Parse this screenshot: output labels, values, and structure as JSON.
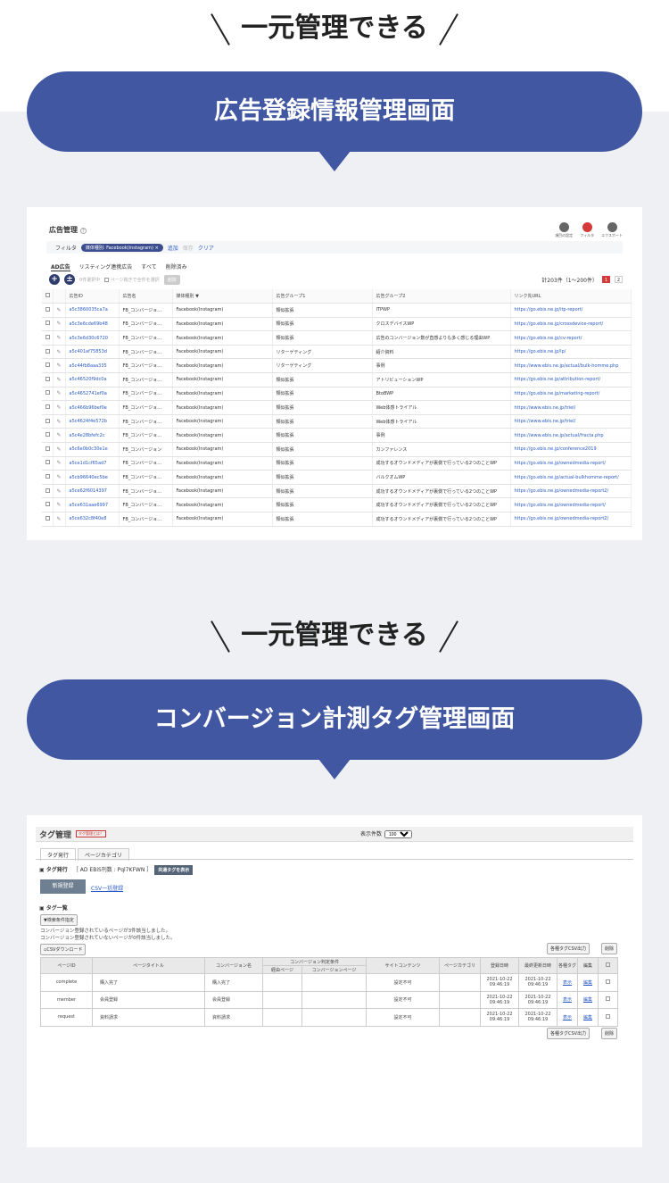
{
  "tagline": "一元管理できる",
  "section1": "広告登録情報管理画面",
  "section2": "コンバージョン計測タグ管理画面",
  "ad": {
    "title": "広告管理",
    "help": "?",
    "icons": [
      {
        "label": "項目の設定",
        "name": "settings-icon"
      },
      {
        "label": "フィルタ",
        "name": "filter-icon"
      },
      {
        "label": "エクスポート",
        "name": "export-icon"
      }
    ],
    "filter_label": "フィルタ",
    "filter_chip": "媒体種別: Facebook(Instagram) ×",
    "filter_add": "追加",
    "filter_save": "保存",
    "filter_clear": "クリア",
    "tabs": [
      "AD広告",
      "リスティング連携広告",
      "すべて",
      "削除済み"
    ],
    "add": "+",
    "upload": "±",
    "selected": "0件選択中",
    "select_all": "ページ跨ぎで全件を選択",
    "delete": "削除",
    "count": "計203件（1〜200件）",
    "pages": [
      "1",
      "2"
    ],
    "cols": [
      "",
      "",
      "広告ID",
      "広告名",
      "媒体種別 ▼",
      "広告グループ1",
      "広告グループ2",
      "リンク先URL"
    ],
    "rows": [
      [
        "a5c3860035ca7a",
        "FB_コンバージョ…",
        "Facebook(Instagram)",
        "類似拡張",
        "ITPWP",
        "https://go.ebis.ne.jp/itp-report/"
      ],
      [
        "a5c3e6cde69b48",
        "FB_コンバージョ…",
        "Facebook(Instagram)",
        "類似拡張",
        "クロスデバイスWP",
        "https://go.ebis.ne.jp/crossdevice-report/"
      ],
      [
        "a5c3e6d30c6720",
        "FB_コンバージョ…",
        "Facebook(Instagram)",
        "類似拡張",
        "広告のコンバージョン数が直感よりも多く感じる理由WP",
        "https://go.ebis.ne.jp/cv-report/"
      ],
      [
        "a5c401af75853d",
        "FB_コンバージョ…",
        "Facebook(Instagram)",
        "リターゲティング",
        "紹介資料",
        "https://go.ebis.ne.jp/lp/"
      ],
      [
        "a5c44fb8aaa335",
        "FB_コンバージョ…",
        "Facebook(Instagram)",
        "リターゲティング",
        "事例",
        "https://www.ebis.ne.jp/actual/bulk-homme.php"
      ],
      [
        "a5c46520f9dc0a",
        "FB_コンバージョ…",
        "Facebook(Instagram)",
        "類似拡張",
        "アトリビューションWP",
        "https://go.ebis.ne.jp/attribution-report/"
      ],
      [
        "a5c4652741ef0a",
        "FB_コンバージョ…",
        "Facebook(Instagram)",
        "類似拡張",
        "BtoBWP",
        "https://go.ebis.ne.jp/marketing-report/"
      ],
      [
        "a5c466b96bef0e",
        "FB_コンバージョ…",
        "Facebook(Instagram)",
        "類似拡張",
        "Web体感トライアル",
        "https://www.ebis.ne.jp/triel/"
      ],
      [
        "a5c4624f4e572b",
        "FB_コンバージョ…",
        "Facebook(Instagram)",
        "類似拡張",
        "Web体感トライアル",
        "https://www.ebis.ne.jp/triel/"
      ],
      [
        "a5c4e28bfefc2c",
        "FB_コンバージョ…",
        "Facebook(Instagram)",
        "類似拡張",
        "事例",
        "https://www.ebis.ne.jp/actual/fracta.php"
      ],
      [
        "a5c6e0b0c30e1e",
        "FB_コンバージョン",
        "Facebook(Instagram)",
        "類似拡張",
        "カンファレンス",
        "https://go.ebis.ne.jp/conference2019"
      ],
      [
        "a5ce1d1cf65ad7",
        "FB_コンバージョ…",
        "Facebook(Instagram)",
        "類似拡張",
        "成功するオウンドメディアが裏側で行っている2つのことWP",
        "https://go.ebis.ne.jp/ownedmedia-report/"
      ],
      [
        "a5cb96640ec5be",
        "FB_コンバージョ…",
        "Facebook(Instagram)",
        "類似拡張",
        "バルクオムWP",
        "https://go.ebis.ne.jp/actual-bulkhomme-report/"
      ],
      [
        "a5ce62f6014397",
        "FB_コンバージョ…",
        "Facebook(Instagram)",
        "類似拡張",
        "成功するオウンドメディアが裏側で行っている2つのことWP",
        "https://go.ebis.ne.jp/ownedmedia-report2/"
      ],
      [
        "a5ce631aae6997",
        "FB_コンバージョ…",
        "Facebook(Instagram)",
        "類似拡張",
        "成功するオウンドメディアが裏側で行っている2つのことWP",
        "https://go.ebis.ne.jp/ownedmedia-report/"
      ],
      [
        "a5ce632c8f40e8",
        "FB_コンバージョ…",
        "Facebook(Instagram)",
        "類似拡張",
        "成功するオウンドメディアが裏側で行っている2つのことWP",
        "https://go.ebis.ne.jp/ownedmedia-report2/"
      ]
    ]
  },
  "tag": {
    "title": "タグ管理",
    "badge": "タグ管理とは？",
    "display_count": "表示件数",
    "display_value": "100",
    "tabs": [
      "タグ発行",
      "ページカテゴリ"
    ],
    "issue_title": "タグ発行",
    "ebis_id": "［ AD EBiS刊数 : Pql7KFWN ］",
    "common_tag": "共通タグを表示",
    "new_btn": "新規登録",
    "csv_bulk": "CSV一括登録",
    "list_title": "タグ一覧",
    "search_btn": "検索条件指定",
    "info1": "コンバージョン登録されているページが3件該当しました。",
    "info2": "コンバージョン登録されていないページが0件該当しました。",
    "csv_dl": "CSVダウンロード",
    "csv_out": "各種タグCSV出力",
    "del": "削除",
    "cond": "コンバージョン判定条件",
    "cols": [
      "ページID",
      "ページタイトル",
      "コンバージョン名",
      "経由ページ",
      "コンバージョンページ",
      "サイトコンテンツ",
      "ページカテゴリ",
      "登録日時",
      "最終更新日時",
      "各種タグ",
      "編集",
      ""
    ],
    "rows": [
      [
        "complete",
        "購入完了",
        "購入完了",
        "",
        "",
        "設定不可",
        "",
        "2021-10-22 09:46:19",
        "2021-10-22 09:46:19",
        "表示",
        "編集"
      ],
      [
        "member",
        "会員登録",
        "会員登録",
        "",
        "",
        "設定不可",
        "",
        "2021-10-22 09:46:19",
        "2021-10-22 09:46:19",
        "表示",
        "編集"
      ],
      [
        "request",
        "資料請求",
        "資料請求",
        "",
        "",
        "設定不可",
        "",
        "2021-10-22 09:46:19",
        "2021-10-22 09:46:19",
        "表示",
        "編集"
      ]
    ]
  }
}
